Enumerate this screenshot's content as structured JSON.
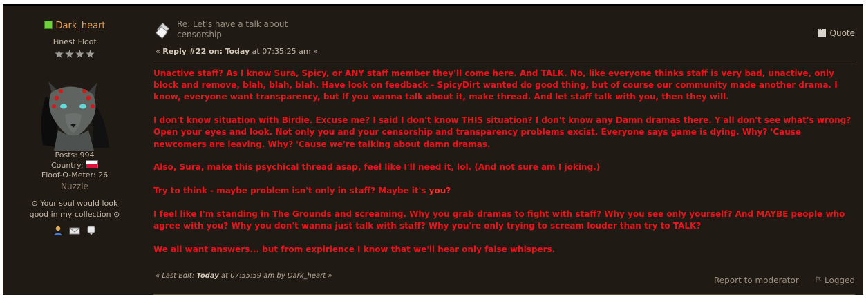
{
  "poster": {
    "name": "Dark_heart",
    "rank": "Finest Floof",
    "posts": "Posts: 994",
    "country_label": "Country:",
    "floof_meter": "Floof-O-Meter: 26",
    "nuzzle": "Nuzzle",
    "signature_line1": "⊙ Your soul would look",
    "signature_line2": "good in my collection ⊙"
  },
  "post": {
    "subject_line1": "Re: Let's have a talk about",
    "subject_line2": "censorship",
    "reply_prefix": "« ",
    "reply_label": "Reply #22 on:",
    "reply_day": "Today",
    "reply_time": " at 07:35:25 am »",
    "quote_label": "Quote",
    "paragraphs": [
      "Unactive staff? As I know Sura, Spicy, or ANY staff member they'll come here. And TALK. No, like everyone thinks staff is very bad, unactive, only block and remove, blah, blah, blah. Have look on feedback - SpicyDirt wanted do good thing, but of course our community made another drama. I know, everyone want transparency, but If you wanna talk about it, make thread. And let staff talk with you, then they will.",
      "I don't know situation with Birdie. Excuse me? I said I don't know THIS situation? I don't know any Damn dramas there. Y'all don't see what's wrong? Open your eyes and look. Not only you and your censorship and transparency problems excist. Everyone says game is dying. Why? 'Cause newcomers are leaving. Why? 'Cause we're talking about damn dramas.",
      "Also, Sura, make this psychical thread asap, feel like I'll need it, lol. (And not sure am I joking.)",
      "I feel like I'm standing in The Grounds and screaming. Why you grab dramas to fight with staff? Why you see only yourself? And MAYBE people who agree with you? Why you don't wanna just talk with staff? Why you're only trying to scream louder than try to TALK?",
      "We all want answers... but from expirience I know that we'll hear only false whispers."
    ],
    "think_text": "Try to think - maybe problem isn't only in staff? Maybe it's ",
    "think_bold": "you?",
    "edit_prefix": "« Last Edit: ",
    "edit_day": "Today",
    "edit_suffix": " at 07:55:59 am by Dark_heart »",
    "report_label": "Report to moderator",
    "logged_label": "Logged"
  },
  "colors": {
    "background": "#201a14",
    "post_text": "#e8141c",
    "username": "#e6a25a",
    "online": "#6fd23c"
  },
  "icons": [
    "online-status-icon",
    "rank-star-icon",
    "subject-post-icon",
    "quote-icon",
    "profile-icon",
    "email-icon",
    "pm-icon",
    "logged-ip-icon"
  ]
}
